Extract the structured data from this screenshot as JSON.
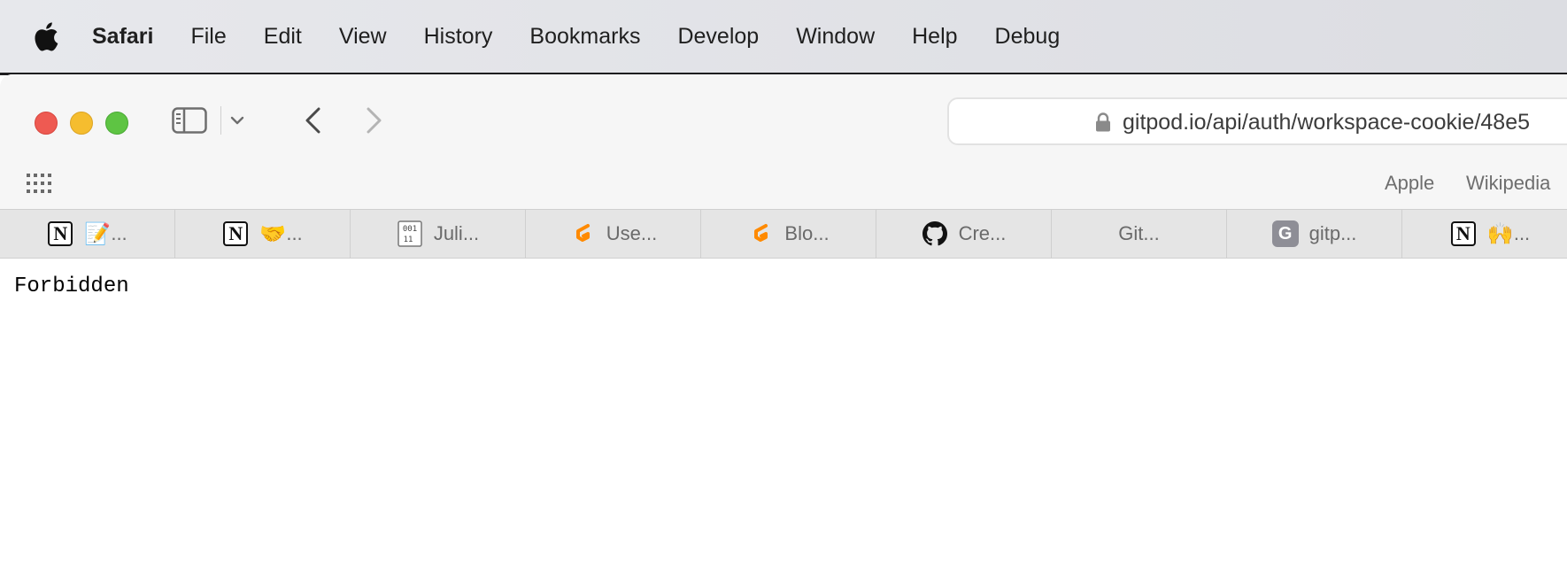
{
  "menubar": {
    "app_name": "Safari",
    "items": [
      "File",
      "Edit",
      "View",
      "History",
      "Bookmarks",
      "Develop",
      "Window",
      "Help",
      "Debug"
    ]
  },
  "toolbar": {
    "url": "gitpod.io/api/auth/workspace-cookie/48e5"
  },
  "favorites": {
    "items": [
      "Apple",
      "Wikipedia"
    ]
  },
  "tabs": [
    {
      "icon": "notion-icon",
      "emoji": "📝",
      "label": "..."
    },
    {
      "icon": "notion-icon",
      "emoji": "🤝",
      "label": "..."
    },
    {
      "icon": "binary-file-icon",
      "label": "Juli..."
    },
    {
      "icon": "gitpod-icon",
      "label": "Use..."
    },
    {
      "icon": "gitpod-icon",
      "label": "Blo..."
    },
    {
      "icon": "github-icon",
      "label": "Cre..."
    },
    {
      "icon": "none",
      "label": "Git..."
    },
    {
      "icon": "g-letter-icon",
      "letter": "G",
      "label": "gitp..."
    },
    {
      "icon": "notion-icon",
      "emoji": "🙌",
      "label": "..."
    }
  ],
  "notion_letter": "N",
  "binary_icon_text": [
    "001",
    "11"
  ],
  "page": {
    "body_text": "Forbidden"
  },
  "colors": {
    "close": "#ee5a52",
    "minimize": "#f5bd2f",
    "maximize": "#5ec443",
    "gitpod_orange": "#ff8a00"
  }
}
